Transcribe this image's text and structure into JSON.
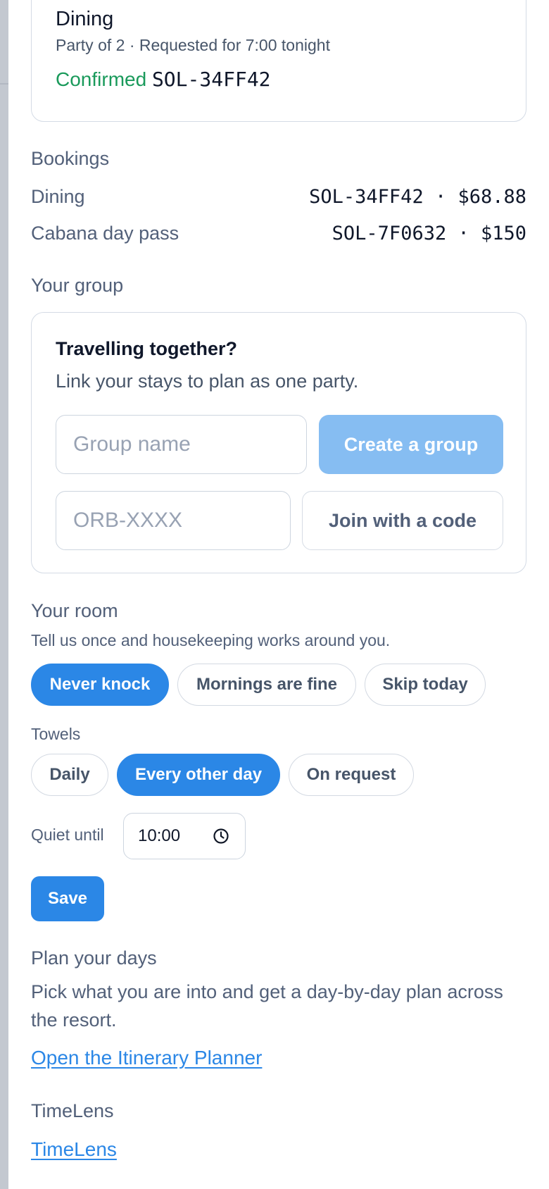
{
  "dining_card": {
    "title": "Dining",
    "subtitle": "Party of 2 · Requested for 7:00 tonight",
    "status": "Confirmed",
    "code": "SOL-34FF42"
  },
  "bookings": {
    "heading": "Bookings",
    "items": [
      {
        "label": "Dining",
        "value": "SOL-34FF42 · $68.88"
      },
      {
        "label": "Cabana day pass",
        "value": "SOL-7F0632 · $150"
      }
    ]
  },
  "group": {
    "heading": "Your group",
    "title": "Travelling together?",
    "subtitle": "Link your stays to plan as one party.",
    "name_placeholder": "Group name",
    "create_label": "Create a group",
    "code_placeholder": "ORB-XXXX",
    "join_label": "Join with a code"
  },
  "room": {
    "heading": "Your room",
    "subtitle": "Tell us once and housekeeping works around you.",
    "knock_options": [
      {
        "label": "Never knock",
        "selected": true
      },
      {
        "label": "Mornings are fine",
        "selected": false
      },
      {
        "label": "Skip today",
        "selected": false
      }
    ],
    "towels_label": "Towels",
    "towel_options": [
      {
        "label": "Daily",
        "selected": false
      },
      {
        "label": "Every other day",
        "selected": true
      },
      {
        "label": "On request",
        "selected": false
      }
    ],
    "quiet_label": "Quiet until",
    "quiet_value": "10:00",
    "save_label": "Save"
  },
  "plan": {
    "heading": "Plan your days",
    "text": "Pick what you are into and get a day-by-day plan across the resort.",
    "link_label": "Open the Itinerary Planner"
  },
  "timelens": {
    "heading": "TimeLens",
    "link_label": "TimeLens"
  },
  "colors": {
    "accent": "#2b87e6",
    "accent_disabled": "#86bdf2",
    "success": "#1a9a5b"
  },
  "icons": {
    "time_picker": "clock-icon"
  }
}
